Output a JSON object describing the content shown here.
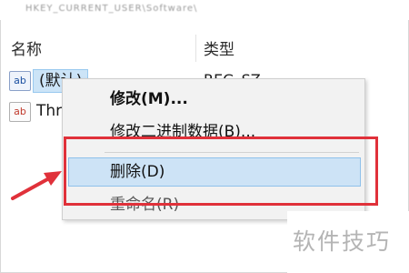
{
  "top_strip": {
    "blurred_text": "HKEY_CURRENT_USER\\Software\\"
  },
  "header": {
    "name_col": "名称",
    "type_col": "类型"
  },
  "rows": [
    {
      "icon": "string-value-icon",
      "icon_text": "ab",
      "name": "(默认)",
      "type": "REG_SZ"
    },
    {
      "icon": "string-value-icon",
      "icon_text": "ab",
      "name": "Thr"
    }
  ],
  "context_menu": {
    "items": [
      {
        "label": "修改(M)..."
      },
      {
        "label": "修改二进制数据(B)..."
      },
      {
        "label": "删除(D)"
      },
      {
        "label": "重命名(R)"
      }
    ]
  },
  "annotation": {
    "highlight_color": "#e0313a"
  },
  "watermark": {
    "text": "软件技巧"
  }
}
